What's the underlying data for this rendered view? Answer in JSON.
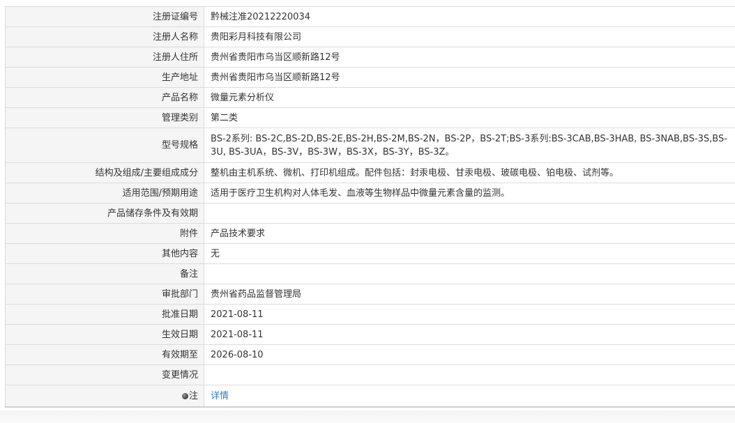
{
  "rows": [
    {
      "label": "注册证编号",
      "value": "黔械注准20212220034"
    },
    {
      "label": "注册人名称",
      "value": "贵阳彩月科技有限公司"
    },
    {
      "label": "注册人住所",
      "value": "贵州省贵阳市乌当区顺新路12号"
    },
    {
      "label": "生产地址",
      "value": "贵州省贵阳市乌当区顺新路12号"
    },
    {
      "label": "产品名称",
      "value": "微量元素分析仪"
    },
    {
      "label": "管理类别",
      "value": "第二类"
    },
    {
      "label": "型号规格",
      "value": "BS-2系列: BS-2C,BS-2D,BS-2E,BS-2H,BS-2M,BS-2N，BS-2P，BS-2T;BS-3系列:BS-3CAB,BS-3HAB, BS-3NAB,BS-3S,BS-3U, BS-3UA，BS-3V，BS-3W，BS-3X，BS-3Y，BS-3Z。"
    },
    {
      "label": "结构及组成/主要组成成分",
      "value": "整机由主机系统、微机、打印机组成。配件包括：封汞电极、甘汞电极、玻碳电极、铂电极、试剂等。"
    },
    {
      "label": "适用范围/预期用途",
      "value": "适用于医疗卫生机构对人体毛发、血液等生物样品中微量元素含量的监测。"
    },
    {
      "label": "产品储存条件及有效期",
      "value": ""
    },
    {
      "label": "附件",
      "value": "产品技术要求"
    },
    {
      "label": "其他内容",
      "value": "无"
    },
    {
      "label": "备注",
      "value": ""
    },
    {
      "label": "审批部门",
      "value": "贵州省药品监督管理局"
    },
    {
      "label": "批准日期",
      "value": "2021-08-11"
    },
    {
      "label": "生效日期",
      "value": "2021-08-11"
    },
    {
      "label": "有效期至",
      "value": "2026-08-10"
    },
    {
      "label": "变更情况",
      "value": ""
    }
  ],
  "note": {
    "icon": "bullet-icon",
    "label": "注",
    "link_text": "详情"
  },
  "colors": {
    "label_bg": "#f5f5f5",
    "border": "#dcdcdc",
    "link": "#2e7cc6",
    "text": "#333333"
  }
}
